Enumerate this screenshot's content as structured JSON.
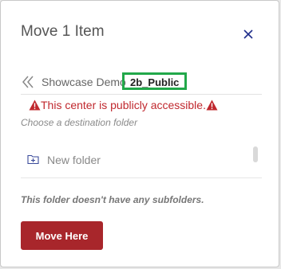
{
  "dialog": {
    "title": "Move 1 Item",
    "close_icon": "close-x-icon"
  },
  "breadcrumb": {
    "back_icon": "double-chevron-left-icon",
    "parent": "Showcase Demo",
    "current": "2b_Public"
  },
  "warning": {
    "icon": "warning-triangle-icon",
    "text": "This center is publicly accessible."
  },
  "hint": "Choose a destination folder",
  "new_folder": {
    "icon": "add-folder-icon",
    "label": "New folder"
  },
  "empty_message": "This folder doesn't have any subfolders.",
  "primary_button": {
    "label": "Move Here"
  },
  "colors": {
    "accent_red": "#a8262b",
    "warning_red": "#c0282e",
    "highlight_green": "#22a84a",
    "close_blue": "#1f2d8a"
  }
}
